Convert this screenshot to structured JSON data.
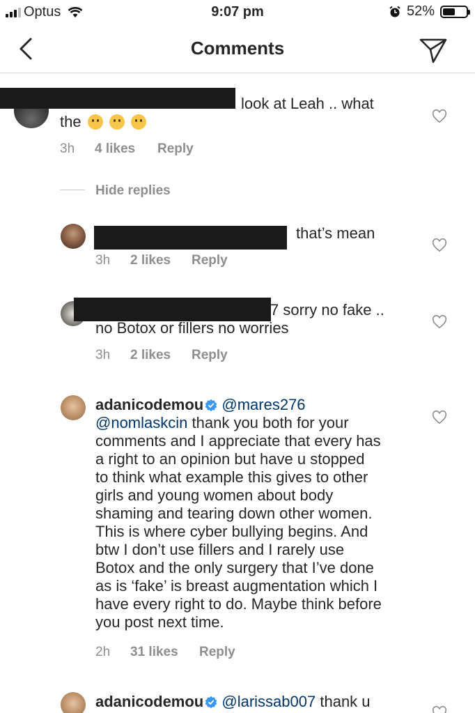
{
  "status_bar": {
    "carrier": "Optus",
    "time": "9:07 pm",
    "battery": "52%",
    "battery_level": 0.52
  },
  "nav": {
    "title": "Comments"
  },
  "comments": [
    {
      "text": "look at Leah .. what",
      "text_line2": "the",
      "time": "3h",
      "likes": "4 likes",
      "reply": "Reply"
    }
  ],
  "hide_replies": "Hide replies",
  "replies": [
    {
      "text": "that’s mean",
      "time": "3h",
      "likes": "2 likes",
      "reply": "Reply"
    },
    {
      "text_start": "7 sorry no fake ..",
      "text_line2": "no Botox or fillers no worries",
      "time": "3h",
      "likes": "2 likes",
      "reply": "Reply"
    },
    {
      "username": "adanicodemou",
      "mention1": "@mares276",
      "mention2": "@nomlaskcin",
      "lines": [
        "thank you both for your",
        "comments and I appreciate that every has",
        "a right to an opinion but have u stopped",
        "to think what example this gives to other",
        "girls and young women about body",
        "shaming and tearing down other women.",
        "This is where cyber bullying begins. And",
        "btw I don’t use fillers and I rarely use",
        "Botox and the only surgery that I’ve done",
        "as is ‘fake’ is breast augmentation which I",
        "have every right to do. Maybe think before",
        "you post next time."
      ],
      "time": "2h",
      "likes": "31 likes",
      "reply": "Reply"
    },
    {
      "username": "adanicodemou",
      "mention1": "@larissab007",
      "text": "thank u"
    }
  ]
}
